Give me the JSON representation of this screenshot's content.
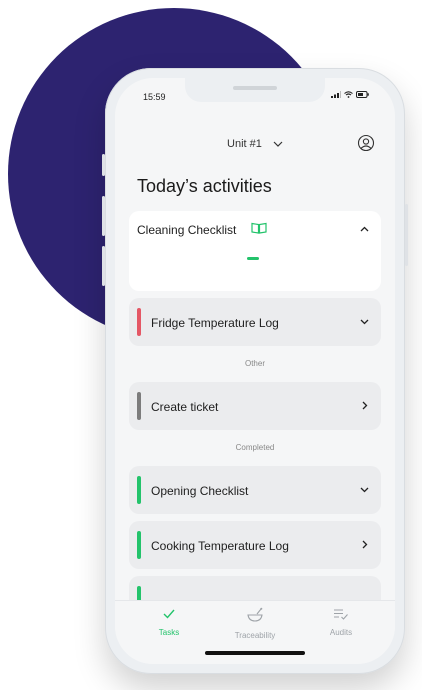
{
  "status_bar": {
    "time": "15:59"
  },
  "header": {
    "unit": "Unit #1",
    "title": "Today’s activities"
  },
  "cards": {
    "cleaning": {
      "label": "Cleaning Checklist"
    },
    "fridge": {
      "label": "Fridge Temperature Log",
      "accent": "#e45765"
    },
    "ticket": {
      "label": "Create ticket",
      "accent": "#7c7c7c"
    },
    "opening": {
      "label": "Opening Checklist",
      "accent": "#23c36b"
    },
    "cooking": {
      "label": "Cooking Temperature Log",
      "accent": "#23c36b"
    }
  },
  "sections": {
    "other": "Other",
    "completed": "Completed"
  },
  "tabs": {
    "tasks": "Tasks",
    "traceability": "Traceability",
    "audits": "Audits"
  },
  "colors": {
    "brand_blob": "#2d2370",
    "accent_green": "#23c36b"
  }
}
